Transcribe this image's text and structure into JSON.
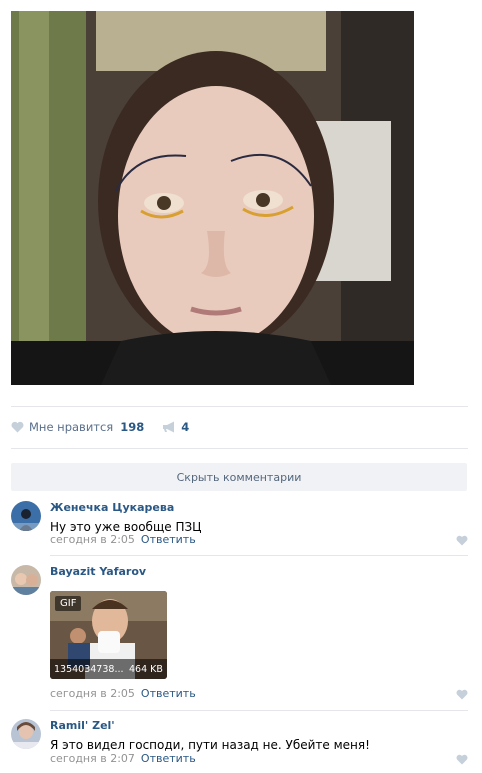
{
  "post": {
    "likes_label": "Мне нравится",
    "likes_count": "198",
    "shares_count": "4"
  },
  "comments_toggle": "Скрыть комментарии",
  "comments": [
    {
      "author": "Женечка Цукарева",
      "text": "Ну это уже вообще ПЗЦ",
      "time": "сегодня в 2:05",
      "reply": "Ответить"
    },
    {
      "author": "Bayazit Yafarov",
      "attachment": {
        "badge": "GIF",
        "name": "1354034738...",
        "size": "464 KB"
      },
      "time": "сегодня в 2:05",
      "reply": "Ответить"
    },
    {
      "author": "Ramil' Zel'",
      "text": "Я это видел господи, пути назад не. Убейте меня!",
      "time": "сегодня в 2:07",
      "reply": "Ответить"
    }
  ],
  "colors": {
    "link": "#2a5885",
    "muted": "#939393",
    "icon": "#c5d0db"
  }
}
